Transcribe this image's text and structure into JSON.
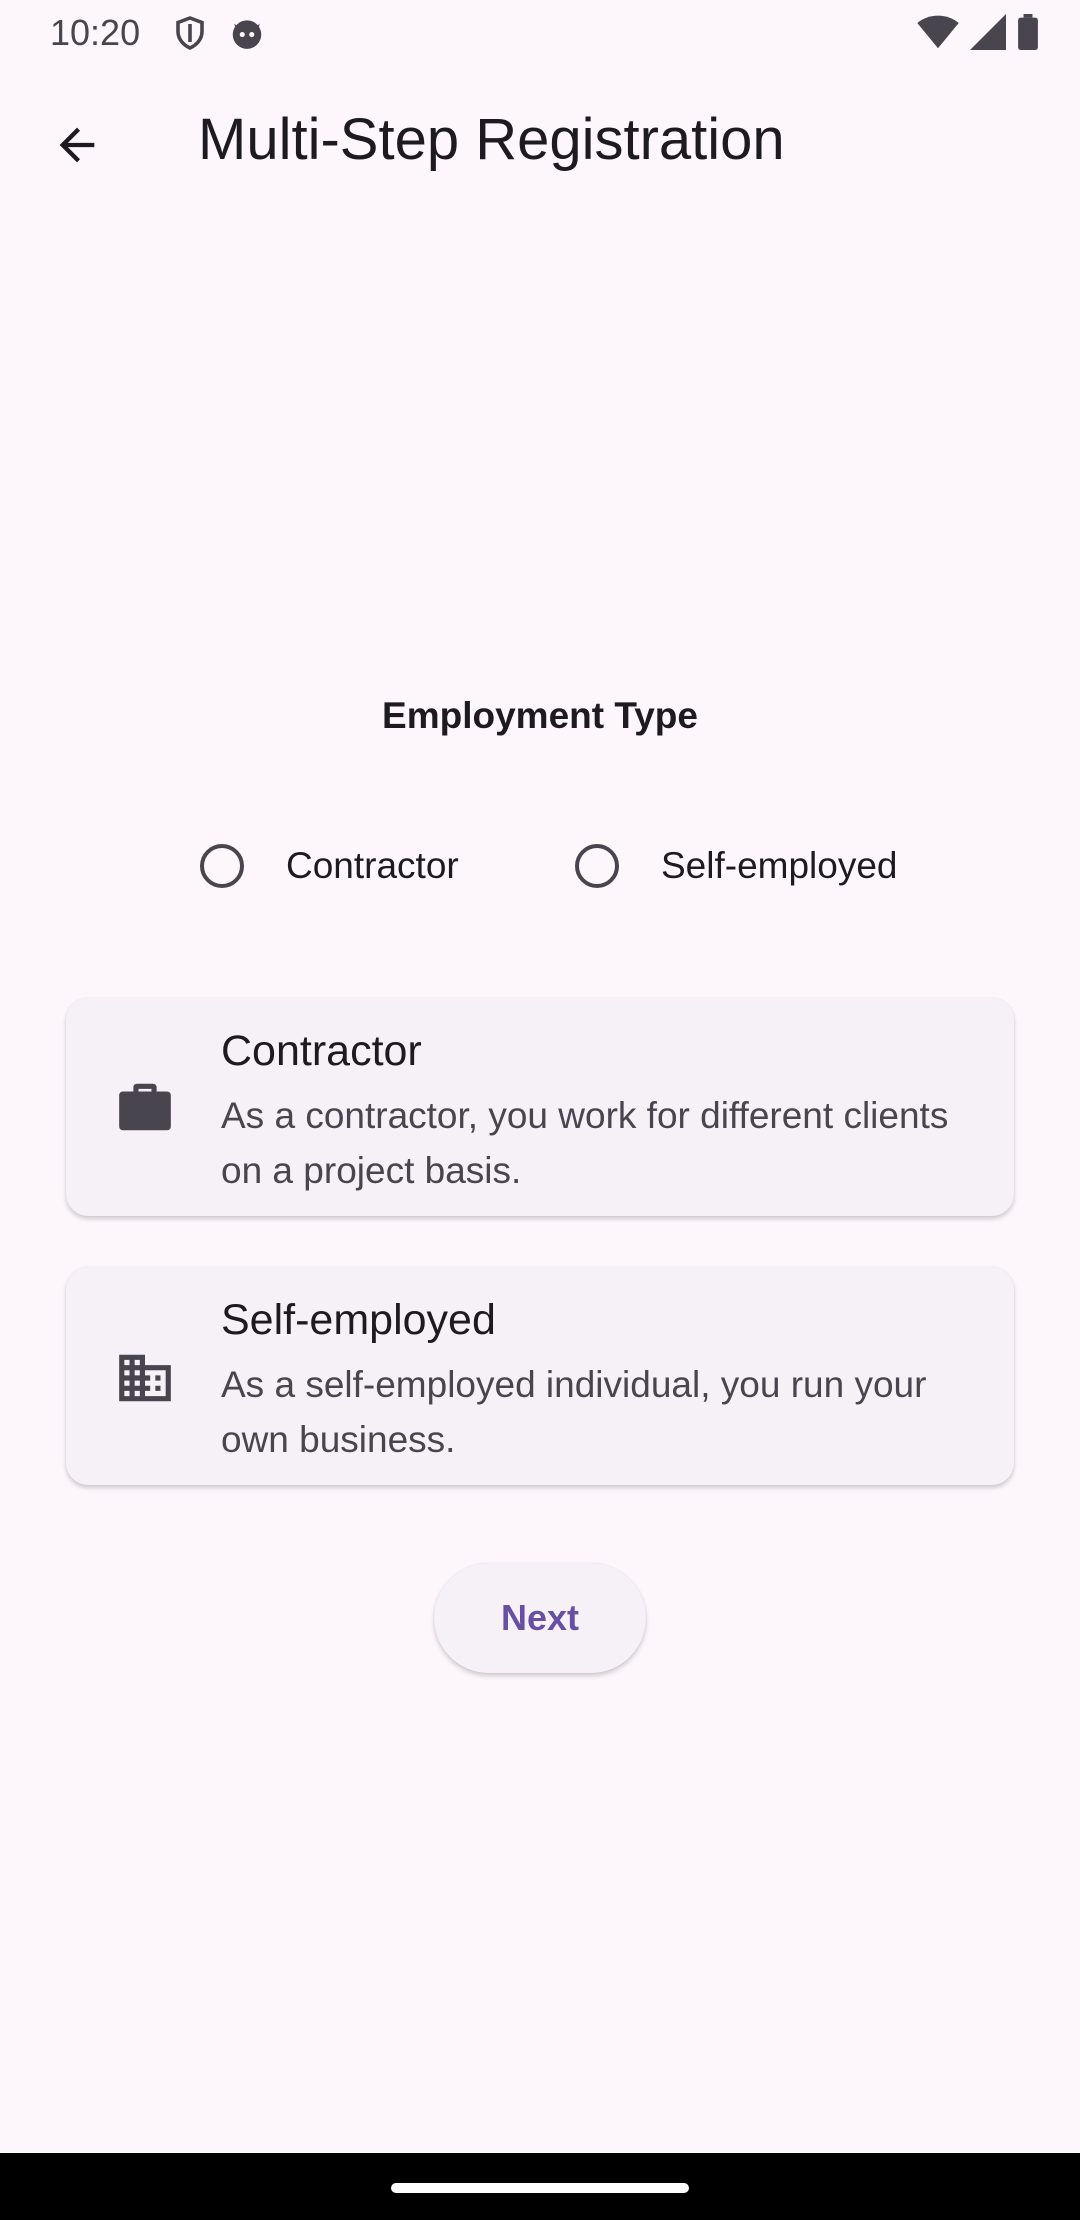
{
  "status_bar": {
    "time": "10:20",
    "left_icons": [
      "shield-icon",
      "cat-face-icon"
    ],
    "right_icons": [
      "wifi-icon",
      "cellular-signal-icon",
      "battery-icon"
    ]
  },
  "app_bar": {
    "title": "Multi-Step Registration",
    "back_icon": "arrow-back-icon"
  },
  "employment": {
    "section_title": "Employment Type",
    "radio_options": [
      {
        "label": "Contractor",
        "selected": false
      },
      {
        "label": "Self-employed",
        "selected": false
      }
    ],
    "cards": [
      {
        "icon": "briefcase-icon",
        "title": "Contractor",
        "description": "As a contractor, you work for different clients on a project basis."
      },
      {
        "icon": "building-icon",
        "title": "Self-employed",
        "description": "As a self-employed individual, you run your own business."
      }
    ]
  },
  "actions": {
    "next_label": "Next"
  },
  "colors": {
    "background": "#fdf7fc",
    "surface": "#f6f1f7",
    "primary": "#6750a4",
    "on_surface": "#1d1b20",
    "on_surface_variant": "#49454f"
  }
}
